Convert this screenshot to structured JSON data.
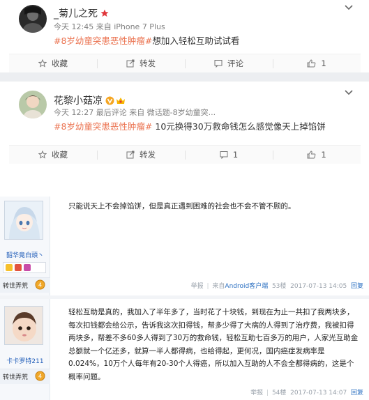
{
  "posts": [
    {
      "username": "_菊儿之死",
      "meta": "今天 12:45 来自 iPhone 7 Plus",
      "topic": "#8岁幼童突患恶性肿瘤#",
      "text": "想加入轻松互助试试看",
      "actions": {
        "favorite": "收藏",
        "repost": "转发",
        "comment": "评论",
        "like": "1"
      }
    },
    {
      "username": "花黎小菇凉",
      "meta": "今天 12:27 最后评论 来自 微话题-8岁幼童突...",
      "topic": "#8岁幼童突患恶性肿瘤#",
      "text": " 10元换得30万救命钱怎么感觉像天上掉馅饼",
      "actions": {
        "favorite": "收藏",
        "repost": "转发",
        "comment": "1",
        "like": "1"
      }
    }
  ],
  "replies": [
    {
      "username": "韶华竟白頭丶",
      "level_label": "转世弄荒",
      "text": "只能说天上不会掉馅饼，但是真正遇到困难的社会也不会不管不顾的。",
      "report": "举报",
      "source_prefix": "来自",
      "source_app": "Android客户端",
      "floor": "53楼",
      "time": "2017-07-13 14:05",
      "reply_btn": "回复"
    },
    {
      "username": "卡卡罗特211",
      "level_label": "转世弄荒",
      "text": "轻松互助是真的，我加入了半年多了，当时花了十块钱，到现在为止一共扣了我两块多，每次扣钱都会给公示，告诉我这次扣得钱，帮多少得了大病的人得到了治疗费，我被扣得两块多，帮差不多60多人得到了30万的救命钱，轻松互助七百多万的用户，人家光互助金总额就一个亿还多，就算一半人都得病，也给得起，更何况，国内癌症发病率是0.024%，10万个人每年有20-30个人得癌，所以加入互助的人不会全都得病的，这是个概率问题。",
      "report": "举报",
      "floor": "54楼",
      "time": "2017-07-13 14:07",
      "reply_btn": "回复"
    }
  ],
  "colors": {
    "topic": "#eb7350",
    "forum_link": "#2a6fc1",
    "band": "#eceef1"
  }
}
